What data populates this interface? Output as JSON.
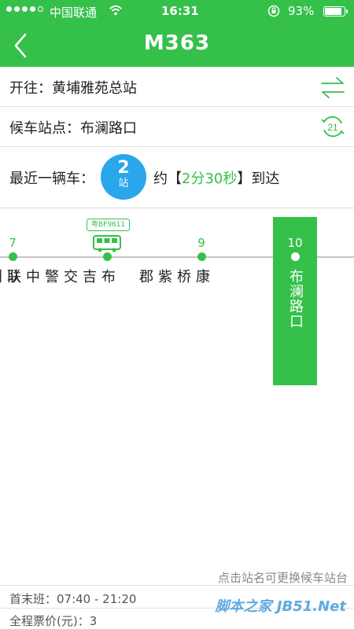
{
  "status_bar": {
    "carrier": "中国联通",
    "time": "16:31",
    "battery": "93%",
    "battery_level": 0.93
  },
  "nav": {
    "title": "M363"
  },
  "direction": {
    "text": "开往：黄埔雅苑总站"
  },
  "waiting_stop": {
    "text": "候车站点：布澜路口",
    "refresh_seconds": "21"
  },
  "nearest_bus": {
    "label": "最近一辆车：",
    "stops_away": "2",
    "stops_unit": "站",
    "arrival_prefix": "约【",
    "arrival_time": "2分30秒",
    "arrival_suffix": "】到达"
  },
  "route": {
    "stations": [
      {
        "index": "7",
        "name": "联创科技园"
      },
      {
        "index": "8",
        "name": "布吉交警中队"
      },
      {
        "index": "9",
        "name": "康桥紫郡"
      },
      {
        "index": "10",
        "name": "布澜路口",
        "current": true
      }
    ],
    "bus_plate": "粤BF9611"
  },
  "footer": {
    "hint": "点击站名可更换候车站台",
    "schedule": "首末班：07:40 - 21:20",
    "fare": "全程票价(元)：3",
    "watermark": "脚本之家 JB51.Net"
  },
  "colors": {
    "brand_green": "#35c04a",
    "bubble_blue": "#2aa6ea"
  }
}
